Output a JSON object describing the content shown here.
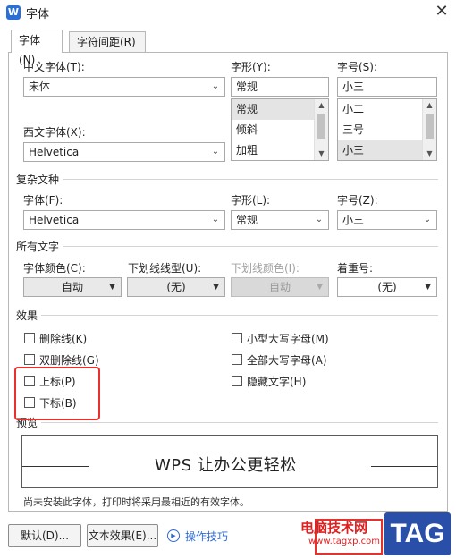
{
  "window": {
    "logo": "W",
    "title": "字体",
    "close": "✕"
  },
  "tabs": [
    {
      "label": "字体(N)",
      "active": true
    },
    {
      "label": "字符间距(R)",
      "active": false
    }
  ],
  "chinese_font": {
    "label": "中文字体(T):",
    "value": "宋体"
  },
  "style": {
    "label": "字形(Y):",
    "value": "常规",
    "options": [
      "常规",
      "倾斜",
      "加粗"
    ],
    "selected": "常规"
  },
  "size": {
    "label": "字号(S):",
    "value": "小三",
    "options": [
      "小二",
      "三号",
      "小三"
    ],
    "selected": "小三"
  },
  "western_font": {
    "label": "西文字体(X):",
    "value": "Helvetica"
  },
  "complex": {
    "section": "复杂文种",
    "font_label": "字体(F):",
    "font_value": "Helvetica",
    "style_label": "字形(L):",
    "style_value": "常规",
    "size_label": "字号(Z):",
    "size_value": "小三"
  },
  "all_text": {
    "section": "所有文字",
    "font_color_label": "字体颜色(C):",
    "font_color_value": "自动",
    "underline_type_label": "下划线线型(U):",
    "underline_type_value": "(无)",
    "underline_color_label": "下划线颜色(I):",
    "underline_color_value": "自动",
    "emphasis_label": "着重号:",
    "emphasis_value": "(无)"
  },
  "effects": {
    "section": "效果",
    "strikethrough": "删除线(K)",
    "double_strikethrough": "双删除线(G)",
    "superscript": "上标(P)",
    "subscript": "下标(B)",
    "small_caps": "小型大写字母(M)",
    "all_caps": "全部大写字母(A)",
    "hidden": "隐藏文字(H)"
  },
  "preview": {
    "section": "预览",
    "text": "WPS 让办公更轻松",
    "note": "尚未安装此字体，打印时将采用最相近的有效字体。"
  },
  "buttons": {
    "default": "默认(D)...",
    "text_effects": "文本效果(E)...",
    "tips": "操作技巧"
  },
  "watermark": {
    "site_name": "电脑技术网",
    "url": "www.tagxp.com",
    "tag": "TAG"
  },
  "colors": {
    "highlight_red": "#e8312d",
    "link_blue": "#2f6ad1",
    "tag_blue": "#2a4fa8"
  }
}
